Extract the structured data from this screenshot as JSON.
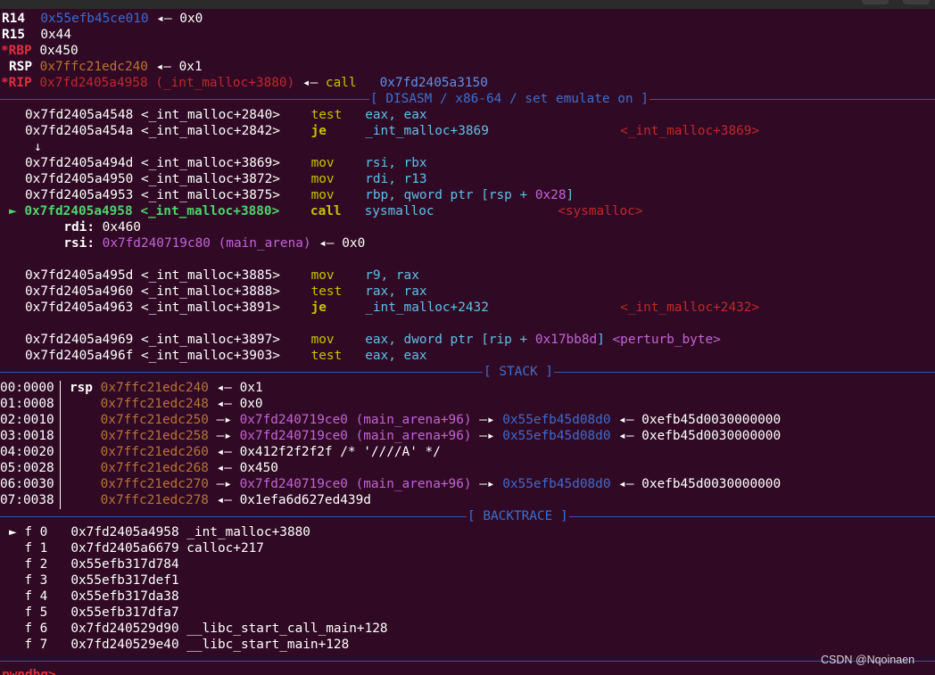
{
  "registers": [
    {
      "name": "R14",
      "changed": false,
      "value": "0x55efb45ce010",
      "arrow": "◂—",
      "deref": "0x0"
    },
    {
      "name": "R15",
      "changed": false,
      "value": "0x44"
    },
    {
      "name": "*RBP",
      "changed": true,
      "value": "0x450"
    },
    {
      "name": "RSP",
      "changed": false,
      "value": "0x7ffc21edc240",
      "arrow": "◂—",
      "deref": "0x1"
    },
    {
      "name": "*RIP",
      "changed": true,
      "value": "0x7fd2405a4958 (_int_malloc+3880)",
      "arrow": "◂—",
      "op": "call",
      "target": "0x7fd2405a3150"
    }
  ],
  "sections": {
    "disasm": "[ DISASM / x86-64 / set emulate on ]",
    "stack": "[ STACK ]",
    "backtrace": "[ BACKTRACE ]"
  },
  "disasm": [
    {
      "addr": "0x7fd2405a4548",
      "sym": "<_int_malloc+2840>",
      "op": "test",
      "args": "eax, eax"
    },
    {
      "addr": "0x7fd2405a454a",
      "sym": "<_int_malloc+2842>",
      "op": "je",
      "args": "_int_malloc+3869",
      "ref": "<_int_malloc+3869>"
    },
    {
      "jump_arrow": "↓"
    },
    {
      "addr": "0x7fd2405a494d",
      "sym": "<_int_malloc+3869>",
      "op": "mov",
      "args": "rsi, rbx"
    },
    {
      "addr": "0x7fd2405a4950",
      "sym": "<_int_malloc+3872>",
      "op": "mov",
      "args": "rdi, r13"
    },
    {
      "addr": "0x7fd2405a4953",
      "sym": "<_int_malloc+3875>",
      "op": "mov",
      "args_a": "rbp, qword ptr [rsp + ",
      "args_num": "0x28",
      "args_b": "]"
    },
    {
      "current": "►",
      "addr": "0x7fd2405a4958",
      "sym": "<_int_malloc+3880>",
      "op": "call",
      "args": "sysmalloc",
      "ref": "<sysmalloc>"
    },
    {
      "arg_name": "rdi",
      "arg_value": "0x460"
    },
    {
      "arg_name": "rsi",
      "arg_value": "0x7fd240719c80 (main_arena)",
      "arrow": "◂—",
      "deref": "0x0"
    },
    {
      "addr": "0x7fd2405a495d",
      "sym": "<_int_malloc+3885>",
      "op": "mov",
      "args": "r9, rax"
    },
    {
      "addr": "0x7fd2405a4960",
      "sym": "<_int_malloc+3888>",
      "op": "test",
      "args": "rax, rax"
    },
    {
      "addr": "0x7fd2405a4963",
      "sym": "<_int_malloc+3891>",
      "op": "je",
      "args": "_int_malloc+2432",
      "ref": "<_int_malloc+2432>"
    },
    {
      "addr": "0x7fd2405a4969",
      "sym": "<_int_malloc+3897>",
      "op": "mov",
      "args_a": "eax, dword ptr [rip + ",
      "args_num": "0x17bb8d",
      "args_b": "]",
      "ref": "<perturb_byte>"
    },
    {
      "addr": "0x7fd2405a496f",
      "sym": "<_int_malloc+3903>",
      "op": "test",
      "args": "eax, eax"
    }
  ],
  "stack": [
    {
      "idx": "00:0000",
      "reg": "rsp",
      "addr": "0x7ffc21edc240",
      "chain": [
        {
          "arrow": "◂—",
          "val": "0x1"
        }
      ]
    },
    {
      "idx": "01:0008",
      "addr": "0x7ffc21edc248",
      "chain": [
        {
          "arrow": "◂—",
          "val": "0x0"
        }
      ]
    },
    {
      "idx": "02:0010",
      "addr": "0x7ffc21edc250",
      "ptr1": "0x7fd240719ce0 (main_arena+96)",
      "ptr2": "0x55efb45d08d0",
      "fin": "0xefb45d0030000000"
    },
    {
      "idx": "03:0018",
      "addr": "0x7ffc21edc258",
      "ptr1": "0x7fd240719ce0 (main_arena+96)",
      "ptr2": "0x55efb45d08d0",
      "fin": "0xefb45d0030000000"
    },
    {
      "idx": "04:0020",
      "addr": "0x7ffc21edc260",
      "chain": [
        {
          "arrow": "◂—",
          "val": "0x412f2f2f2f /* '////A' */"
        }
      ]
    },
    {
      "idx": "05:0028",
      "addr": "0x7ffc21edc268",
      "chain": [
        {
          "arrow": "◂—",
          "val": "0x450"
        }
      ]
    },
    {
      "idx": "06:0030",
      "addr": "0x7ffc21edc270",
      "ptr1": "0x7fd240719ce0 (main_arena+96)",
      "ptr2": "0x55efb45d08d0",
      "fin": "0xefb45d0030000000"
    },
    {
      "idx": "07:0038",
      "addr": "0x7ffc21edc278",
      "chain": [
        {
          "arrow": "◂—",
          "val": "0x1efa6d627ed439d"
        }
      ]
    }
  ],
  "ptr_arrow": "—▸",
  "val_arrow": "◂—",
  "backtrace": [
    {
      "marker": "►",
      "frame": "f 0",
      "addr": "0x7fd2405a4958",
      "sym": "_int_malloc+3880"
    },
    {
      "frame": "f 1",
      "addr": "0x7fd2405a6679",
      "sym": "calloc+217"
    },
    {
      "frame": "f 2",
      "addr": "0x55efb317d784",
      "sym": ""
    },
    {
      "frame": "f 3",
      "addr": "0x55efb317def1",
      "sym": ""
    },
    {
      "frame": "f 4",
      "addr": "0x55efb317da38",
      "sym": ""
    },
    {
      "frame": "f 5",
      "addr": "0x55efb317dfa7",
      "sym": ""
    },
    {
      "frame": "f 6",
      "addr": "0x7fd240529d90",
      "sym": "__libc_start_call_main+128"
    },
    {
      "frame": "f 7",
      "addr": "0x7fd240529e40",
      "sym": "__libc_start_main+128"
    }
  ],
  "watermark": "CSDN @Nqoinaen",
  "prompt": "pwndbg>",
  "colors": {
    "background": "#300a24",
    "separator": "#3b4fa8",
    "changed_register": "#e02e3c",
    "heap_address": "#3d6ad0",
    "stack_address": "#b87333",
    "code_address": "#c1272d",
    "data_address": "#c264d6",
    "mnemonic": "#c4c400",
    "current_line": "#4cd46c"
  }
}
